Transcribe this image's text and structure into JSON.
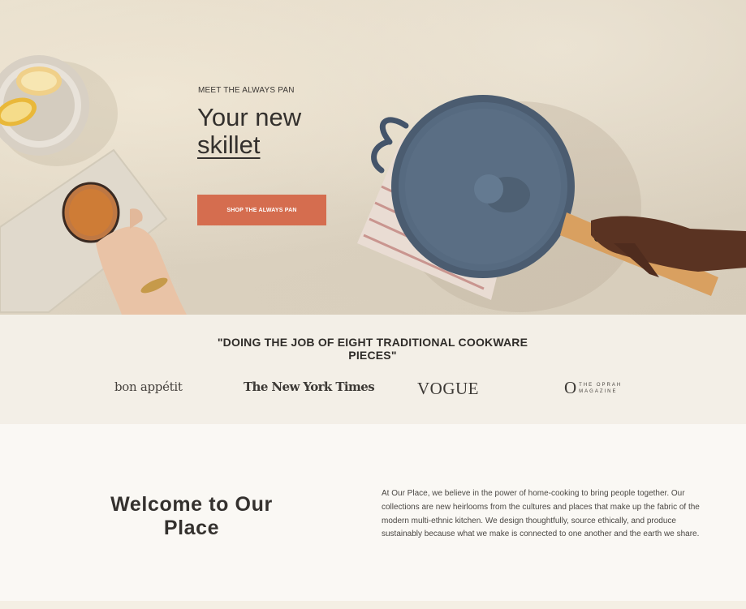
{
  "hero": {
    "eyebrow": "MEET THE ALWAYS PAN",
    "title_line1": "Your new",
    "title_line2": "skillet",
    "cta_label": "SHOP THE ALWAYS PAN"
  },
  "press": {
    "quote": "\"DOING THE JOB OF EIGHT TRADITIONAL COOKWARE PIECES\"",
    "logos": {
      "bon_appetit": "bon appétit",
      "nyt": "The New York Times",
      "vogue": "VOGUE",
      "oprah_o": "O",
      "oprah_line1": "THE OPRAH",
      "oprah_line2": "MAGAZINE"
    }
  },
  "welcome": {
    "title": "Welcome to Our Place",
    "body": "At Our Place, we believe in the power of home-cooking to bring people together. Our collections are new heirlooms from the cultures and places that make up the fabric of the modern multi-ethnic kitchen. We design thoughtfully, source ethically, and produce sustainably because what we make is connected to one another and the earth we share."
  },
  "colors": {
    "cta": "#d56d4f",
    "pan": "#4a5a6c",
    "press_bg": "#f3efe7",
    "page_bg": "#faf8f4"
  }
}
